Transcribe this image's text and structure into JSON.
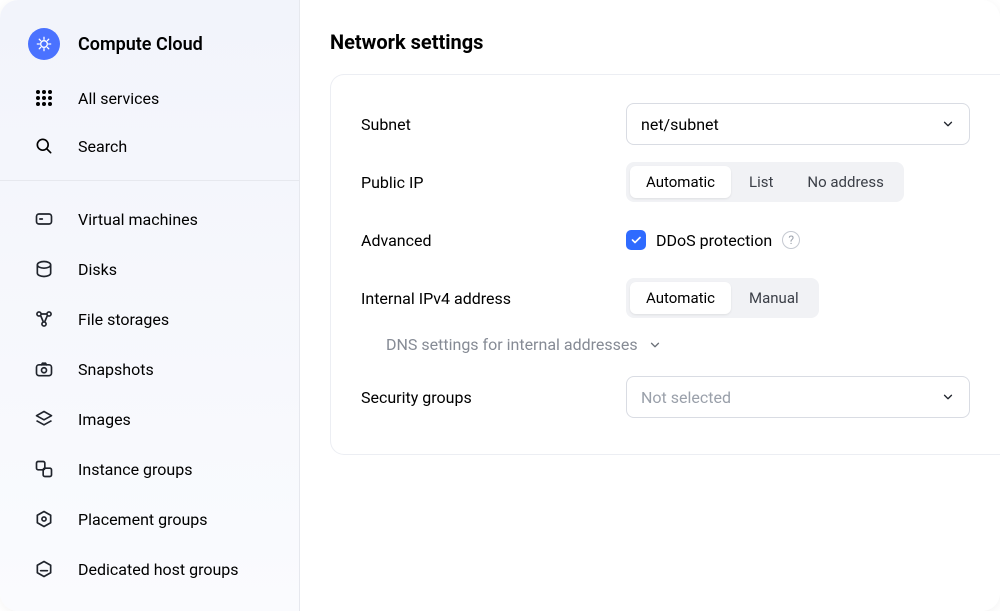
{
  "sidebar": {
    "brand": "Compute Cloud",
    "all_services": "All services",
    "search": "Search",
    "items": [
      {
        "label": "Virtual machines"
      },
      {
        "label": "Disks"
      },
      {
        "label": "File storages"
      },
      {
        "label": "Snapshots"
      },
      {
        "label": "Images"
      },
      {
        "label": "Instance groups"
      },
      {
        "label": "Placement groups"
      },
      {
        "label": "Dedicated host groups"
      }
    ]
  },
  "page": {
    "title": "Network settings"
  },
  "form": {
    "subnet": {
      "label": "Subnet",
      "value": "net/subnet"
    },
    "public_ip": {
      "label": "Public IP",
      "options": {
        "automatic": "Automatic",
        "list": "List",
        "none": "No address"
      }
    },
    "advanced": {
      "label": "Advanced",
      "ddos_label": "DDoS protection"
    },
    "internal_ipv4": {
      "label": "Internal IPv4 address",
      "options": {
        "automatic": "Automatic",
        "manual": "Manual"
      }
    },
    "dns_collapsible": "DNS settings for internal addresses",
    "security_groups": {
      "label": "Security groups",
      "placeholder": "Not selected"
    }
  }
}
